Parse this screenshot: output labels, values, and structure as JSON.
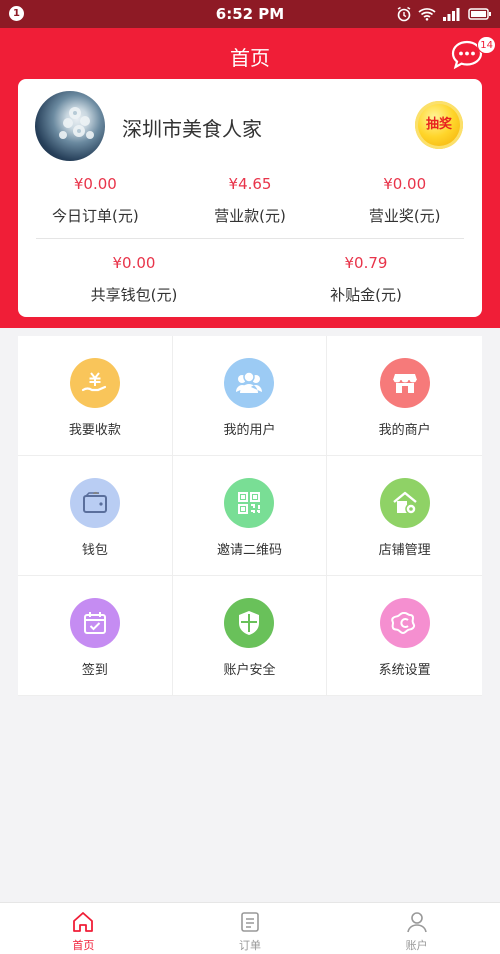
{
  "status_bar": {
    "notification_count": "1",
    "time": "6:52 PM"
  },
  "header": {
    "title": "首页",
    "message_badge": "14"
  },
  "merchant": {
    "name": "深圳市美食人家",
    "lottery_label": "抽奖",
    "stats_row1": [
      {
        "value": "¥0.00",
        "label": "今日订单(元)"
      },
      {
        "value": "¥4.65",
        "label": "营业款(元)"
      },
      {
        "value": "¥0.00",
        "label": "营业奖(元)"
      }
    ],
    "stats_row2": [
      {
        "value": "¥0.00",
        "label": "共享钱包(元)"
      },
      {
        "value": "¥0.79",
        "label": "补贴金(元)"
      }
    ]
  },
  "menu": [
    {
      "label": "我要收款",
      "icon": "receive-money-icon",
      "color": "#f9c55a"
    },
    {
      "label": "我的用户",
      "icon": "users-icon",
      "color": "#9ccbf4"
    },
    {
      "label": "我的商户",
      "icon": "store-icon",
      "color": "#f67a7a"
    },
    {
      "label": "钱包",
      "icon": "wallet-icon",
      "color": "#b9cdf3"
    },
    {
      "label": "邀请二维码",
      "icon": "qr-code-icon",
      "color": "#79de95"
    },
    {
      "label": "店铺管理",
      "icon": "shop-settings-icon",
      "color": "#8fd266"
    },
    {
      "label": "签到",
      "icon": "calendar-check-icon",
      "color": "#c58cf2"
    },
    {
      "label": "账户安全",
      "icon": "shield-icon",
      "color": "#69c15a"
    },
    {
      "label": "系统设置",
      "icon": "settings-icon",
      "color": "#f58fd0"
    }
  ],
  "tabs": [
    {
      "label": "首页",
      "icon": "home-icon",
      "active": true
    },
    {
      "label": "订单",
      "icon": "orders-icon",
      "active": false
    },
    {
      "label": "账户",
      "icon": "account-icon",
      "active": false
    }
  ],
  "colors": {
    "primary": "#f01e37",
    "status_bar": "#8e1a25",
    "amount": "#e8344a"
  }
}
